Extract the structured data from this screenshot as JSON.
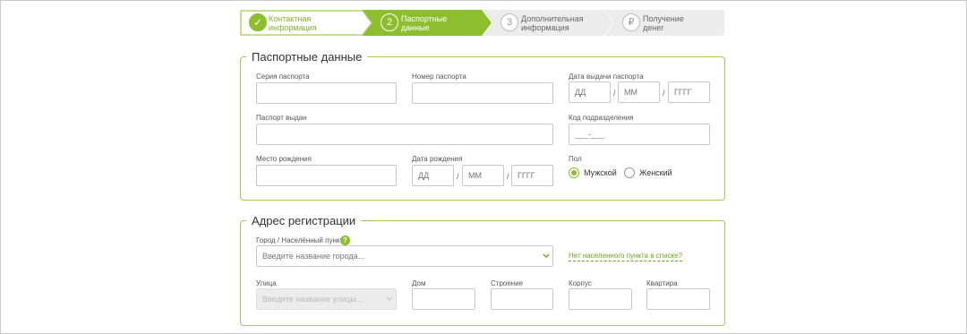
{
  "stepper": {
    "steps": [
      {
        "num": "✓",
        "label": "Контактная\nинформация",
        "state": "done"
      },
      {
        "num": "2",
        "label": "Паспортные\nданные",
        "state": "active"
      },
      {
        "num": "3",
        "label": "Дополнительная\nинформация",
        "state": "pending"
      },
      {
        "num": "₽",
        "label": "Получение\nденег",
        "state": "pending"
      }
    ]
  },
  "passport": {
    "title": "Паспортные данные",
    "series_label": "Серия паспорта",
    "number_label": "Номер паспорта",
    "issue_date_label": "Дата выдачи паспорта",
    "issue_day_placeholder": "ДД",
    "issue_month_placeholder": "ММ",
    "issue_year_placeholder": "ГГГГ",
    "issued_by_label": "Паспорт выдан",
    "dept_code_label": "Код подразделения",
    "dept_code_placeholder": "___-___",
    "birthplace_label": "Место рождения",
    "birthdate_label": "Дата рождения",
    "birth_day_placeholder": "ДД",
    "birth_month_placeholder": "ММ",
    "birth_year_placeholder": "ГГГГ",
    "date_separator": "/",
    "gender_label": "Пол",
    "gender_male": "Мужской",
    "gender_female": "Женский",
    "gender_selected": "Мужской"
  },
  "address": {
    "title": "Адрес регистрации",
    "city_label": "Город / Населённый пункт",
    "help_icon": "?",
    "city_placeholder": "Введите название города...",
    "no_city_link": "Нет населенного пункта в списке?",
    "street_label": "Улица",
    "street_placeholder": "Введите название улицы...",
    "house_label": "Дом",
    "building_label": "Строение",
    "block_label": "Корпус",
    "apartment_label": "Квартира"
  },
  "colors": {
    "accent": "#8cbe2d",
    "border": "#a5c94f",
    "pending": "#ececec"
  }
}
